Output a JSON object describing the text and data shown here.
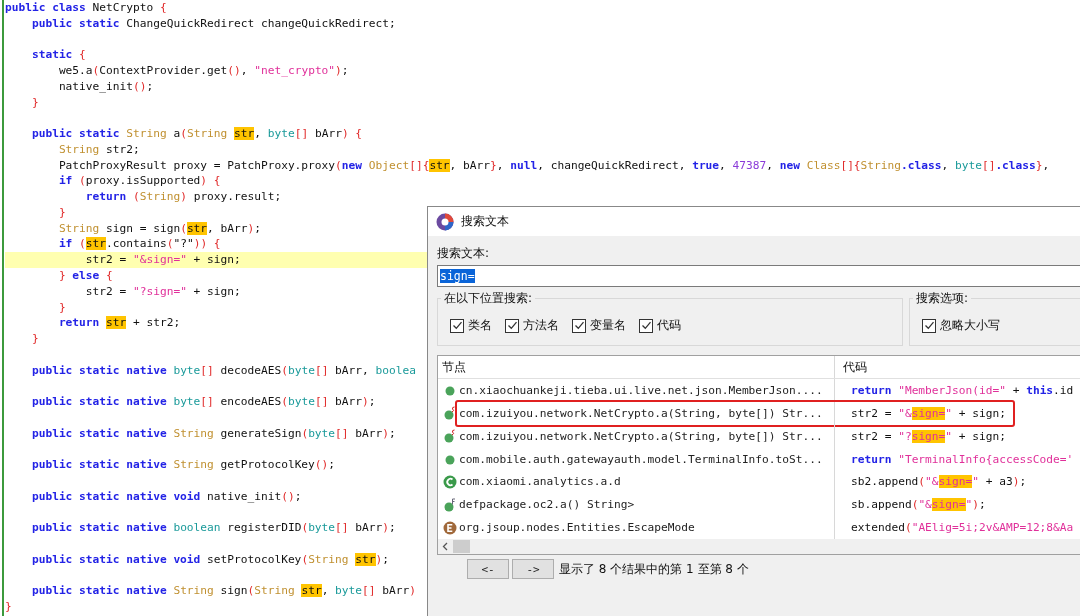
{
  "editor": {
    "lines": [
      {
        "kind": "code",
        "highlighted": false,
        "tokens": [
          {
            "kind": "keyword",
            "text": "public class"
          },
          {
            "kind": "plain",
            "text": " NetCrypto "
          },
          {
            "kind": "bracket",
            "text": "{"
          }
        ]
      },
      {
        "kind": "code",
        "highlighted": false,
        "tokens": [
          {
            "kind": "keyword",
            "text": "    public static"
          },
          {
            "kind": "plain",
            "text": " ChangeQuickRedirect changeQuickRedirect;"
          }
        ]
      },
      {
        "kind": "blank"
      },
      {
        "kind": "code",
        "highlighted": false,
        "tokens": [
          {
            "kind": "keyword",
            "text": "    static"
          },
          {
            "kind": "bracket",
            "text": " {"
          }
        ]
      },
      {
        "kind": "code",
        "highlighted": false,
        "tokens": [
          {
            "kind": "plain",
            "text": "        we5.a"
          },
          {
            "kind": "bracket",
            "text": "("
          },
          {
            "kind": "plain",
            "text": "ContextProvider.get"
          },
          {
            "kind": "bracket",
            "text": "()"
          },
          {
            "kind": "plain",
            "text": ", "
          },
          {
            "kind": "string",
            "text": "\"net_crypto\""
          },
          {
            "kind": "bracket",
            "text": ")"
          },
          {
            "kind": "plain",
            "text": ";"
          }
        ]
      },
      {
        "kind": "code",
        "highlighted": false,
        "tokens": [
          {
            "kind": "plain",
            "text": "        native_init"
          },
          {
            "kind": "bracket",
            "text": "()"
          },
          {
            "kind": "plain",
            "text": ";"
          }
        ]
      },
      {
        "kind": "code",
        "highlighted": false,
        "tokens": [
          {
            "kind": "bracket",
            "text": "    }"
          }
        ]
      },
      {
        "kind": "blank"
      },
      {
        "kind": "code",
        "highlighted": false,
        "tokens": [
          {
            "kind": "keyword",
            "text": "    public static"
          },
          {
            "kind": "type",
            "text": " String"
          },
          {
            "kind": "plain",
            "text": " a"
          },
          {
            "kind": "bracket",
            "text": "("
          },
          {
            "kind": "type",
            "text": "String "
          },
          {
            "kind": "match",
            "text": "str"
          },
          {
            "kind": "plain",
            "text": ", "
          },
          {
            "kind": "primitive",
            "text": "byte"
          },
          {
            "kind": "bracket",
            "text": "[]"
          },
          {
            "kind": "plain",
            "text": " bArr"
          },
          {
            "kind": "bracket",
            "text": ") {"
          }
        ]
      },
      {
        "kind": "code",
        "highlighted": false,
        "tokens": [
          {
            "kind": "type",
            "text": "        String"
          },
          {
            "kind": "plain",
            "text": " str2;"
          }
        ]
      },
      {
        "kind": "code",
        "highlighted": false,
        "tokens": [
          {
            "kind": "plain",
            "text": "        PatchProxyResult proxy = PatchProxy.proxy"
          },
          {
            "kind": "bracket",
            "text": "("
          },
          {
            "kind": "keyword",
            "text": "new"
          },
          {
            "kind": "type",
            "text": " Object"
          },
          {
            "kind": "bracket",
            "text": "[]{"
          },
          {
            "kind": "match",
            "text": "str"
          },
          {
            "kind": "plain",
            "text": ", bArr"
          },
          {
            "kind": "bracket",
            "text": "}"
          },
          {
            "kind": "plain",
            "text": ", "
          },
          {
            "kind": "keyword",
            "text": "null"
          },
          {
            "kind": "plain",
            "text": ", changeQuickRedirect, "
          },
          {
            "kind": "keyword",
            "text": "true"
          },
          {
            "kind": "plain",
            "text": ", "
          },
          {
            "kind": "number",
            "text": "47387"
          },
          {
            "kind": "plain",
            "text": ", "
          },
          {
            "kind": "keyword",
            "text": "new"
          },
          {
            "kind": "type",
            "text": " Class"
          },
          {
            "kind": "bracket",
            "text": "[]{"
          },
          {
            "kind": "type",
            "text": "String"
          },
          {
            "kind": "keyword",
            "text": ".class"
          },
          {
            "kind": "plain",
            "text": ", "
          },
          {
            "kind": "primitive",
            "text": "byte"
          },
          {
            "kind": "bracket",
            "text": "[]"
          },
          {
            "kind": "keyword",
            "text": ".class"
          },
          {
            "kind": "bracket",
            "text": "}"
          },
          {
            "kind": "plain",
            "text": ","
          }
        ]
      },
      {
        "kind": "code",
        "highlighted": false,
        "tokens": [
          {
            "kind": "keyword",
            "text": "        if"
          },
          {
            "kind": "bracket",
            "text": " ("
          },
          {
            "kind": "plain",
            "text": "proxy.isSupported"
          },
          {
            "kind": "bracket",
            "text": ") {"
          }
        ]
      },
      {
        "kind": "code",
        "highlighted": false,
        "tokens": [
          {
            "kind": "keyword",
            "text": "            return"
          },
          {
            "kind": "bracket",
            "text": " ("
          },
          {
            "kind": "type",
            "text": "String"
          },
          {
            "kind": "bracket",
            "text": ")"
          },
          {
            "kind": "plain",
            "text": " proxy.result;"
          }
        ]
      },
      {
        "kind": "code",
        "highlighted": false,
        "tokens": [
          {
            "kind": "bracket",
            "text": "        }"
          }
        ]
      },
      {
        "kind": "code",
        "highlighted": false,
        "tokens": [
          {
            "kind": "type",
            "text": "        String"
          },
          {
            "kind": "plain",
            "text": " sign = sign"
          },
          {
            "kind": "bracket",
            "text": "("
          },
          {
            "kind": "match",
            "text": "str"
          },
          {
            "kind": "plain",
            "text": ", bArr"
          },
          {
            "kind": "bracket",
            "text": ")"
          },
          {
            "kind": "plain",
            "text": ";"
          }
        ]
      },
      {
        "kind": "code",
        "highlighted": false,
        "tokens": [
          {
            "kind": "keyword",
            "text": "        if"
          },
          {
            "kind": "bracket",
            "text": " ("
          },
          {
            "kind": "match",
            "text": "str"
          },
          {
            "kind": "plain",
            "text": ".contains"
          },
          {
            "kind": "bracket",
            "text": "("
          },
          {
            "kind": "plain",
            "text": "\"?\""
          },
          {
            "kind": "bracket",
            "text": ")) {"
          }
        ]
      },
      {
        "kind": "code",
        "highlighted": true,
        "tokens": [
          {
            "kind": "plain",
            "text": "            str2 = "
          },
          {
            "kind": "string",
            "text": "\"&sign=\""
          },
          {
            "kind": "plain",
            "text": " + sign;"
          }
        ]
      },
      {
        "kind": "code",
        "highlighted": false,
        "tokens": [
          {
            "kind": "bracket",
            "text": "        }"
          },
          {
            "kind": "keyword",
            "text": " else"
          },
          {
            "kind": "bracket",
            "text": " {"
          }
        ]
      },
      {
        "kind": "code",
        "highlighted": false,
        "tokens": [
          {
            "kind": "plain",
            "text": "            str2 = "
          },
          {
            "kind": "string",
            "text": "\"?sign=\""
          },
          {
            "kind": "plain",
            "text": " + sign;"
          }
        ]
      },
      {
        "kind": "code",
        "highlighted": false,
        "tokens": [
          {
            "kind": "bracket",
            "text": "        }"
          }
        ]
      },
      {
        "kind": "code",
        "highlighted": false,
        "tokens": [
          {
            "kind": "keyword",
            "text": "        return "
          },
          {
            "kind": "match",
            "text": "str"
          },
          {
            "kind": "plain",
            "text": " + str2;"
          }
        ]
      },
      {
        "kind": "code",
        "highlighted": false,
        "tokens": [
          {
            "kind": "bracket",
            "text": "    }"
          }
        ]
      },
      {
        "kind": "blank"
      },
      {
        "kind": "code",
        "highlighted": false,
        "tokens": [
          {
            "kind": "keyword",
            "text": "    public static native"
          },
          {
            "kind": "primitive",
            "text": " byte"
          },
          {
            "kind": "bracket",
            "text": "[]"
          },
          {
            "kind": "plain",
            "text": " decodeAES"
          },
          {
            "kind": "bracket",
            "text": "("
          },
          {
            "kind": "primitive",
            "text": "byte"
          },
          {
            "kind": "bracket",
            "text": "[]"
          },
          {
            "kind": "plain",
            "text": " bArr, "
          },
          {
            "kind": "primitive",
            "text": "boolea"
          }
        ]
      },
      {
        "kind": "blank"
      },
      {
        "kind": "code",
        "highlighted": false,
        "tokens": [
          {
            "kind": "keyword",
            "text": "    public static native"
          },
          {
            "kind": "primitive",
            "text": " byte"
          },
          {
            "kind": "bracket",
            "text": "[]"
          },
          {
            "kind": "plain",
            "text": " encodeAES"
          },
          {
            "kind": "bracket",
            "text": "("
          },
          {
            "kind": "primitive",
            "text": "byte"
          },
          {
            "kind": "bracket",
            "text": "[]"
          },
          {
            "kind": "plain",
            "text": " bArr"
          },
          {
            "kind": "bracket",
            "text": ")"
          },
          {
            "kind": "plain",
            "text": ";"
          }
        ]
      },
      {
        "kind": "blank"
      },
      {
        "kind": "code",
        "highlighted": false,
        "tokens": [
          {
            "kind": "keyword",
            "text": "    public static native"
          },
          {
            "kind": "type",
            "text": " String"
          },
          {
            "kind": "plain",
            "text": " generateSign"
          },
          {
            "kind": "bracket",
            "text": "("
          },
          {
            "kind": "primitive",
            "text": "byte"
          },
          {
            "kind": "bracket",
            "text": "[]"
          },
          {
            "kind": "plain",
            "text": " bArr"
          },
          {
            "kind": "bracket",
            "text": ")"
          },
          {
            "kind": "plain",
            "text": ";"
          }
        ]
      },
      {
        "kind": "blank"
      },
      {
        "kind": "code",
        "highlighted": false,
        "tokens": [
          {
            "kind": "keyword",
            "text": "    public static native"
          },
          {
            "kind": "type",
            "text": " String"
          },
          {
            "kind": "plain",
            "text": " getProtocolKey"
          },
          {
            "kind": "bracket",
            "text": "()"
          },
          {
            "kind": "plain",
            "text": ";"
          }
        ]
      },
      {
        "kind": "blank"
      },
      {
        "kind": "code",
        "highlighted": false,
        "tokens": [
          {
            "kind": "keyword",
            "text": "    public static native void"
          },
          {
            "kind": "plain",
            "text": " native_init"
          },
          {
            "kind": "bracket",
            "text": "()"
          },
          {
            "kind": "plain",
            "text": ";"
          }
        ]
      },
      {
        "kind": "blank"
      },
      {
        "kind": "code",
        "highlighted": false,
        "tokens": [
          {
            "kind": "keyword",
            "text": "    public static native"
          },
          {
            "kind": "primitive",
            "text": " boolean"
          },
          {
            "kind": "plain",
            "text": " registerDID"
          },
          {
            "kind": "bracket",
            "text": "("
          },
          {
            "kind": "primitive",
            "text": "byte"
          },
          {
            "kind": "bracket",
            "text": "[]"
          },
          {
            "kind": "plain",
            "text": " bArr"
          },
          {
            "kind": "bracket",
            "text": ")"
          },
          {
            "kind": "plain",
            "text": ";"
          }
        ]
      },
      {
        "kind": "blank"
      },
      {
        "kind": "code",
        "highlighted": false,
        "tokens": [
          {
            "kind": "keyword",
            "text": "    public static native void"
          },
          {
            "kind": "plain",
            "text": " setProtocolKey"
          },
          {
            "kind": "bracket",
            "text": "("
          },
          {
            "kind": "type",
            "text": "String "
          },
          {
            "kind": "match",
            "text": "str"
          },
          {
            "kind": "bracket",
            "text": ")"
          },
          {
            "kind": "plain",
            "text": ";"
          }
        ]
      },
      {
        "kind": "blank"
      },
      {
        "kind": "code",
        "highlighted": false,
        "tokens": [
          {
            "kind": "keyword",
            "text": "    public static native"
          },
          {
            "kind": "type",
            "text": " String"
          },
          {
            "kind": "plain",
            "text": " sign"
          },
          {
            "kind": "bracket",
            "text": "("
          },
          {
            "kind": "type",
            "text": "String "
          },
          {
            "kind": "match",
            "text": "str"
          },
          {
            "kind": "plain",
            "text": ", "
          },
          {
            "kind": "primitive",
            "text": "byte"
          },
          {
            "kind": "bracket",
            "text": "[]"
          },
          {
            "kind": "plain",
            "text": " bArr"
          },
          {
            "kind": "bracket",
            "text": ")"
          }
        ]
      },
      {
        "kind": "code",
        "highlighted": false,
        "tokens": [
          {
            "kind": "bracket",
            "text": "}"
          }
        ]
      }
    ]
  },
  "dialog": {
    "title": "搜索文本",
    "search_label": "搜索文本:",
    "search_value": "sign=",
    "location_group": {
      "title": "在以下位置搜索:",
      "options": [
        {
          "label": "类名",
          "checked": true
        },
        {
          "label": "方法名",
          "checked": true
        },
        {
          "label": "变量名",
          "checked": true
        },
        {
          "label": "代码",
          "checked": true
        }
      ]
    },
    "options_group": {
      "title": "搜索选项:",
      "options": [
        {
          "label": "忽略大小写",
          "checked": true
        }
      ]
    },
    "table": {
      "columns": [
        "节点",
        "代码"
      ],
      "rows": [
        {
          "kind": "method",
          "annotated": false,
          "node": "cn.xiaochuankeji.tieba.ui.live.net.json.MemberJson....",
          "code": [
            {
              "kind": "keyword",
              "text": "return"
            },
            {
              "kind": "string",
              "text": " \"MemberJson(id=\""
            },
            {
              "kind": "plain",
              "text": " + "
            },
            {
              "kind": "keyword",
              "text": "this"
            },
            {
              "kind": "plain",
              "text": ".id"
            }
          ]
        },
        {
          "kind": "static_method",
          "annotated": true,
          "node": "com.izuiyou.network.NetCrypto.a(String, byte[]) Str...",
          "code": [
            {
              "kind": "plain",
              "text": "str2 = "
            },
            {
              "kind": "string",
              "text": "\"&"
            },
            {
              "kind": "string_match",
              "text": "sign="
            },
            {
              "kind": "string",
              "text": "\""
            },
            {
              "kind": "plain",
              "text": " + sign;"
            }
          ]
        },
        {
          "kind": "static_method",
          "annotated": false,
          "node": "com.izuiyou.network.NetCrypto.a(String, byte[]) Str...",
          "code": [
            {
              "kind": "plain",
              "text": "str2 = "
            },
            {
              "kind": "string",
              "text": "\"?"
            },
            {
              "kind": "string_match",
              "text": "sign="
            },
            {
              "kind": "string",
              "text": "\""
            },
            {
              "kind": "plain",
              "text": " + sign;"
            }
          ]
        },
        {
          "kind": "method",
          "annotated": false,
          "node": "com.mobile.auth.gatewayauth.model.TerminalInfo.toSt...",
          "code": [
            {
              "kind": "keyword",
              "text": "return"
            },
            {
              "kind": "string",
              "text": " \"TerminalInfo{accessCode='"
            }
          ]
        },
        {
          "kind": "class",
          "annotated": false,
          "node": "com.xiaomi.analytics.a.d",
          "code": [
            {
              "kind": "plain",
              "text": "sb2.append"
            },
            {
              "kind": "bracket",
              "text": "("
            },
            {
              "kind": "string",
              "text": "\"&"
            },
            {
              "kind": "string_match",
              "text": "sign="
            },
            {
              "kind": "string",
              "text": "\""
            },
            {
              "kind": "plain",
              "text": " + a3"
            },
            {
              "kind": "bracket",
              "text": ")"
            },
            {
              "kind": "plain",
              "text": ";"
            }
          ]
        },
        {
          "kind": "final_method",
          "annotated": false,
          "node": "defpackage.oc2.a() String>",
          "code": [
            {
              "kind": "plain",
              "text": "sb.append"
            },
            {
              "kind": "bracket",
              "text": "("
            },
            {
              "kind": "string",
              "text": "\"&"
            },
            {
              "kind": "string_match",
              "text": "sign="
            },
            {
              "kind": "string",
              "text": "\""
            },
            {
              "kind": "bracket",
              "text": ")"
            },
            {
              "kind": "plain",
              "text": ";"
            }
          ]
        },
        {
          "kind": "enum",
          "annotated": false,
          "node": "org.jsoup.nodes.Entities.EscapeMode",
          "code": [
            {
              "kind": "plain",
              "text": "extended"
            },
            {
              "kind": "bracket",
              "text": "("
            },
            {
              "kind": "string",
              "text": "\"AElig=5i;2v&AMP=12;8&Aa"
            }
          ]
        }
      ]
    },
    "prev_button": "<-",
    "next_button": "->",
    "status": "显示了 8 个结果中的第 1 至第 8 个"
  }
}
